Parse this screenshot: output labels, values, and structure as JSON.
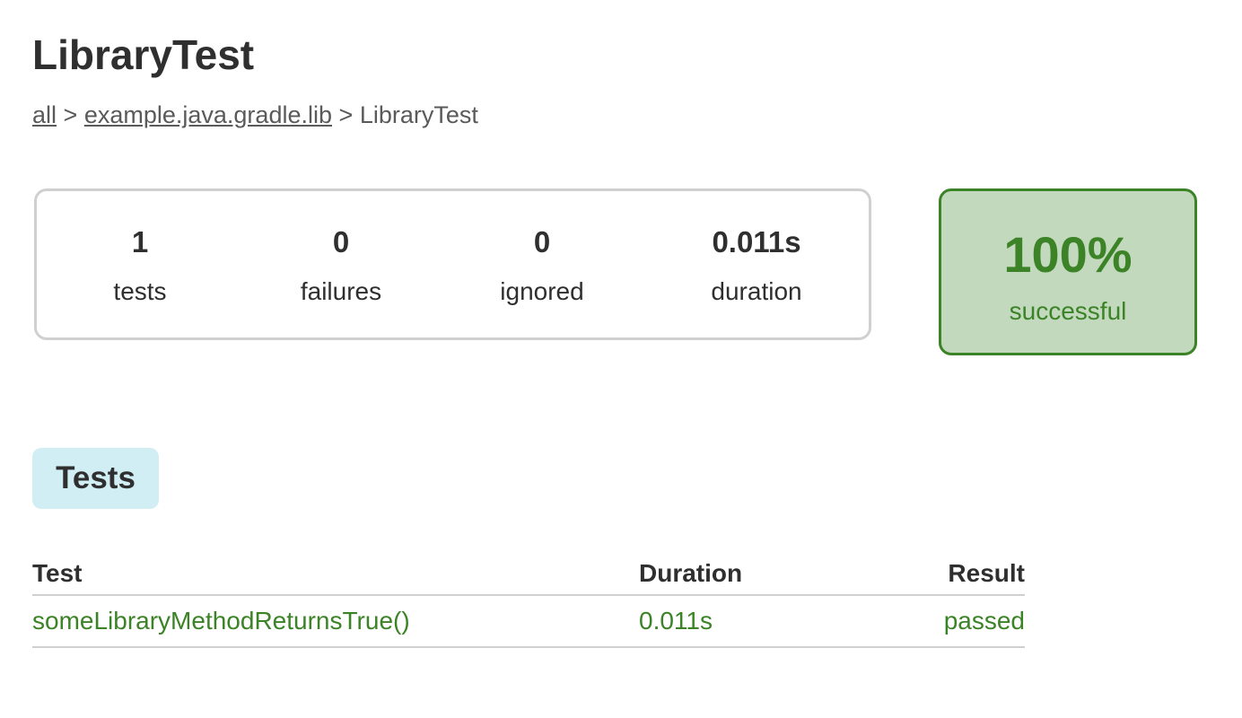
{
  "title": "LibraryTest",
  "breadcrumb": {
    "items": [
      "all",
      "example.java.gradle.lib"
    ],
    "separator": ">",
    "current": "LibraryTest"
  },
  "summary": [
    {
      "value": "1",
      "label": "tests"
    },
    {
      "value": "0",
      "label": "failures"
    },
    {
      "value": "0",
      "label": "ignored"
    },
    {
      "value": "0.011s",
      "label": "duration"
    }
  ],
  "success": {
    "percent": "100%",
    "label": "successful",
    "color": "#3b8326"
  },
  "tabs": [
    {
      "label": "Tests"
    }
  ],
  "table": {
    "headers": [
      "Test",
      "Duration",
      "Result"
    ],
    "rows": [
      {
        "test": "someLibraryMethodReturnsTrue()",
        "duration": "0.011s",
        "result": "passed"
      }
    ]
  }
}
